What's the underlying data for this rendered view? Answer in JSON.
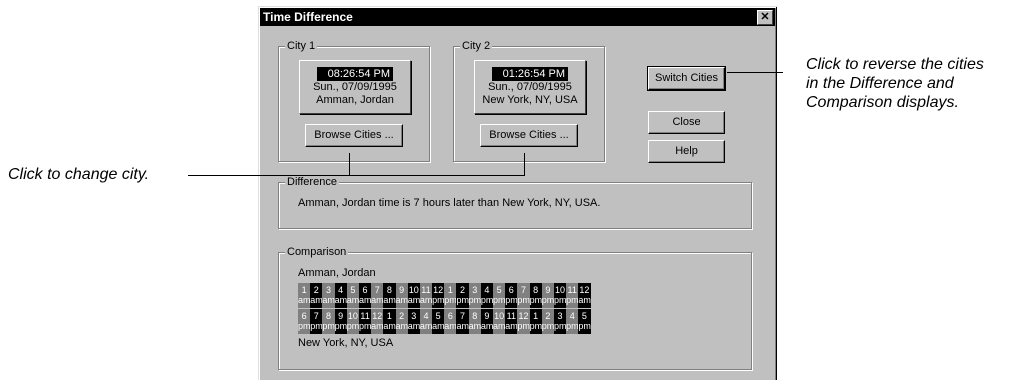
{
  "window": {
    "title": "Time Difference",
    "close_glyph": "✕"
  },
  "city1": {
    "group_label": "City 1",
    "time": "08:26:54 PM",
    "date": "Sun., 07/09/1995",
    "city": "Amman, Jordan",
    "browse_button": "Browse Cities ..."
  },
  "city2": {
    "group_label": "City 2",
    "time": "01:26:54 PM",
    "date": "Sun., 07/09/1995",
    "city": "New York, NY, USA",
    "browse_button": "Browse Cities ..."
  },
  "buttons": {
    "switch": "Switch Cities",
    "close": "Close",
    "help": "Help"
  },
  "difference": {
    "group_label": "Difference",
    "text": "Amman, Jordan time is 7 hours later than New York, NY, USA."
  },
  "comparison": {
    "group_label": "Comparison",
    "city_top": "Amman, Jordan",
    "city_bottom": "New York, NY, USA",
    "top_row": [
      {
        "h": "1",
        "p": "am",
        "s": "gray"
      },
      {
        "h": "2",
        "p": "am",
        "s": "black"
      },
      {
        "h": "3",
        "p": "am",
        "s": "gray"
      },
      {
        "h": "4",
        "p": "am",
        "s": "black"
      },
      {
        "h": "5",
        "p": "am",
        "s": "gray"
      },
      {
        "h": "6",
        "p": "am",
        "s": "black"
      },
      {
        "h": "7",
        "p": "am",
        "s": "gray"
      },
      {
        "h": "8",
        "p": "am",
        "s": "black"
      },
      {
        "h": "9",
        "p": "am",
        "s": "gray"
      },
      {
        "h": "10",
        "p": "am",
        "s": "black"
      },
      {
        "h": "11",
        "p": "am",
        "s": "gray"
      },
      {
        "h": "12",
        "p": "pm",
        "s": "black"
      },
      {
        "h": "1",
        "p": "pm",
        "s": "gray"
      },
      {
        "h": "2",
        "p": "pm",
        "s": "black"
      },
      {
        "h": "3",
        "p": "pm",
        "s": "gray"
      },
      {
        "h": "4",
        "p": "pm",
        "s": "black"
      },
      {
        "h": "5",
        "p": "pm",
        "s": "gray"
      },
      {
        "h": "6",
        "p": "pm",
        "s": "black"
      },
      {
        "h": "7",
        "p": "pm",
        "s": "gray"
      },
      {
        "h": "8",
        "p": "pm",
        "s": "black"
      },
      {
        "h": "9",
        "p": "pm",
        "s": "gray"
      },
      {
        "h": "10",
        "p": "pm",
        "s": "black"
      },
      {
        "h": "11",
        "p": "pm",
        "s": "gray"
      },
      {
        "h": "12",
        "p": "am",
        "s": "black"
      }
    ],
    "bottom_row": [
      {
        "h": "6",
        "p": "pm",
        "s": "gray"
      },
      {
        "h": "7",
        "p": "pm",
        "s": "black"
      },
      {
        "h": "8",
        "p": "pm",
        "s": "gray"
      },
      {
        "h": "9",
        "p": "pm",
        "s": "black"
      },
      {
        "h": "10",
        "p": "pm",
        "s": "gray"
      },
      {
        "h": "11",
        "p": "pm",
        "s": "black"
      },
      {
        "h": "12",
        "p": "am",
        "s": "gray"
      },
      {
        "h": "1",
        "p": "am",
        "s": "black"
      },
      {
        "h": "2",
        "p": "am",
        "s": "gray"
      },
      {
        "h": "3",
        "p": "am",
        "s": "black"
      },
      {
        "h": "4",
        "p": "am",
        "s": "gray"
      },
      {
        "h": "5",
        "p": "am",
        "s": "black"
      },
      {
        "h": "6",
        "p": "am",
        "s": "gray"
      },
      {
        "h": "7",
        "p": "am",
        "s": "black"
      },
      {
        "h": "8",
        "p": "am",
        "s": "gray"
      },
      {
        "h": "9",
        "p": "am",
        "s": "black"
      },
      {
        "h": "10",
        "p": "am",
        "s": "gray"
      },
      {
        "h": "11",
        "p": "am",
        "s": "black"
      },
      {
        "h": "12",
        "p": "pm",
        "s": "gray"
      },
      {
        "h": "1",
        "p": "pm",
        "s": "black"
      },
      {
        "h": "2",
        "p": "pm",
        "s": "gray"
      },
      {
        "h": "3",
        "p": "pm",
        "s": "black"
      },
      {
        "h": "4",
        "p": "pm",
        "s": "gray"
      },
      {
        "h": "5",
        "p": "pm",
        "s": "black"
      }
    ]
  },
  "callouts": {
    "switch_line1": "Click to reverse the cities",
    "switch_line2": "in the Difference and",
    "switch_line3": "Comparison displays.",
    "browse": "Click to change city."
  }
}
